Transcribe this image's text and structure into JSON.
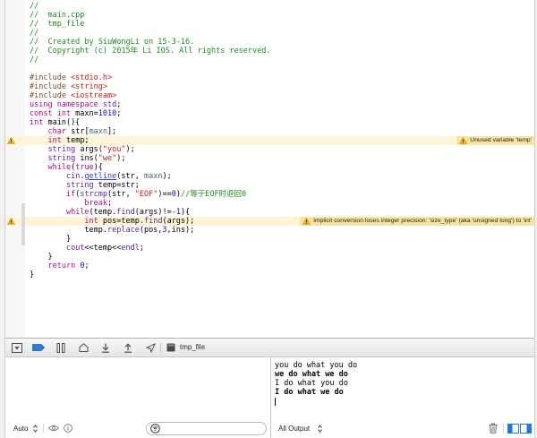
{
  "editor": {
    "lines": [
      {
        "tokens": [
          {
            "t": "//",
            "k": "cm"
          }
        ]
      },
      {
        "tokens": [
          {
            "t": "//  main.cpp",
            "k": "cm"
          }
        ]
      },
      {
        "tokens": [
          {
            "t": "//  tmp_file",
            "k": "cm"
          }
        ]
      },
      {
        "tokens": [
          {
            "t": "//",
            "k": "cm"
          }
        ]
      },
      {
        "tokens": [
          {
            "t": "//  Created by SiuWongLi on 15-3-16.",
            "k": "cm"
          }
        ]
      },
      {
        "tokens": [
          {
            "t": "//  Copyright (c) 2015年 Li IOS. All rights reserved.",
            "k": "cm"
          }
        ]
      },
      {
        "tokens": [
          {
            "t": "//",
            "k": "cm"
          }
        ]
      },
      {
        "tokens": []
      },
      {
        "tokens": [
          {
            "t": "#include ",
            "k": "pp"
          },
          {
            "t": "<stdio.h>",
            "k": "st"
          }
        ]
      },
      {
        "tokens": [
          {
            "t": "#include ",
            "k": "pp"
          },
          {
            "t": "<string>",
            "k": "st"
          }
        ]
      },
      {
        "tokens": [
          {
            "t": "#include ",
            "k": "pp"
          },
          {
            "t": "<iostream>",
            "k": "st"
          }
        ]
      },
      {
        "tokens": [
          {
            "t": "using namespace",
            "k": "kw"
          },
          {
            "t": " "
          },
          {
            "t": "std",
            "k": "sy"
          },
          {
            "t": ";"
          }
        ]
      },
      {
        "tokens": [
          {
            "t": "const int",
            "k": "kw"
          },
          {
            "t": " maxn="
          },
          {
            "t": "1010",
            "k": "nm"
          },
          {
            "t": ";"
          }
        ]
      },
      {
        "tokens": [
          {
            "t": "int",
            "k": "kw"
          },
          {
            "t": " main(){"
          }
        ]
      },
      {
        "tokens": [
          {
            "t": "    "
          },
          {
            "t": "char",
            "k": "kw"
          },
          {
            "t": " str["
          },
          {
            "t": "maxn",
            "k": "pj"
          },
          {
            "t": "];"
          }
        ]
      },
      {
        "tokens": [
          {
            "t": "    "
          },
          {
            "t": "int",
            "k": "kw"
          },
          {
            "t": " temp;"
          }
        ],
        "warning": "Unused variable 'temp'"
      },
      {
        "tokens": [
          {
            "t": "    "
          },
          {
            "t": "string",
            "k": "sy"
          },
          {
            "t": " args("
          },
          {
            "t": "\"you\"",
            "k": "st"
          },
          {
            "t": ");"
          }
        ]
      },
      {
        "tokens": [
          {
            "t": "    "
          },
          {
            "t": "string",
            "k": "sy"
          },
          {
            "t": " ins("
          },
          {
            "t": "\"we\"",
            "k": "st"
          },
          {
            "t": ");"
          }
        ]
      },
      {
        "tokens": [
          {
            "t": "    "
          },
          {
            "t": "while",
            "k": "kw"
          },
          {
            "t": "("
          },
          {
            "t": "true",
            "k": "kw"
          },
          {
            "t": "){"
          }
        ]
      },
      {
        "tokens": [
          {
            "t": "        "
          },
          {
            "t": "cin",
            "k": "sy"
          },
          {
            "t": "."
          },
          {
            "t": "getline",
            "k": "lk"
          },
          {
            "t": "(str, "
          },
          {
            "t": "maxn",
            "k": "pj"
          },
          {
            "t": ");"
          }
        ]
      },
      {
        "tokens": [
          {
            "t": "        "
          },
          {
            "t": "string",
            "k": "sy"
          },
          {
            "t": " temp=str;"
          }
        ]
      },
      {
        "tokens": [
          {
            "t": "        "
          },
          {
            "t": "if",
            "k": "kw"
          },
          {
            "t": "("
          },
          {
            "t": "strcmp",
            "k": "sy"
          },
          {
            "t": "(str, "
          },
          {
            "t": "\"EOF\"",
            "k": "st"
          },
          {
            "t": ")=="
          },
          {
            "t": "0",
            "k": "nm"
          },
          {
            "t": ")"
          },
          {
            "t": "//等于EOF时退回0",
            "k": "cm"
          }
        ]
      },
      {
        "tokens": [
          {
            "t": "            "
          },
          {
            "t": "break",
            "k": "kw"
          },
          {
            "t": ";"
          }
        ]
      },
      {
        "tokens": [
          {
            "t": "        "
          },
          {
            "t": "while",
            "k": "kw"
          },
          {
            "t": "(temp."
          },
          {
            "t": "find",
            "k": "sy"
          },
          {
            "t": "(args)!="
          },
          {
            "t": "-1",
            "k": "nm"
          },
          {
            "t": "){"
          }
        ]
      },
      {
        "tokens": [
          {
            "t": "            "
          },
          {
            "t": "int",
            "k": "kw"
          },
          {
            "t": " pos=temp."
          },
          {
            "t": "find",
            "k": "sy"
          },
          {
            "t": "(args);"
          }
        ],
        "warning": "Implicit conversion loses integer precision: 'size_type' (aka 'unsigned long') to 'int'"
      },
      {
        "tokens": [
          {
            "t": "            temp."
          },
          {
            "t": "replace",
            "k": "sy"
          },
          {
            "t": "(pos,"
          },
          {
            "t": "3",
            "k": "nm"
          },
          {
            "t": ",ins);"
          }
        ]
      },
      {
        "tokens": [
          {
            "t": "        }"
          }
        ]
      },
      {
        "tokens": [
          {
            "t": "        "
          },
          {
            "t": "cout",
            "k": "sy"
          },
          {
            "t": "<<temp<<"
          },
          {
            "t": "endl",
            "k": "sy"
          },
          {
            "t": ";"
          }
        ]
      },
      {
        "tokens": [
          {
            "t": "    }"
          }
        ]
      },
      {
        "tokens": [
          {
            "t": "    "
          },
          {
            "t": "return",
            "k": "kw"
          },
          {
            "t": " "
          },
          {
            "t": "0",
            "k": "nm"
          },
          {
            "t": ";"
          }
        ]
      },
      {
        "tokens": [
          {
            "t": "}"
          }
        ]
      }
    ]
  },
  "debug_bar": {
    "target_label": "tmp_file"
  },
  "variables_pane": {
    "scope_label": "Auto"
  },
  "console": {
    "output_filter": "All Output",
    "lines": [
      {
        "text": "you do what you do",
        "bold": false
      },
      {
        "text": "we do what we do",
        "bold": true
      },
      {
        "text": "I do what you do",
        "bold": false
      },
      {
        "text": "I do what we do",
        "bold": true
      }
    ]
  },
  "icons": {
    "editor": [
      "warning-icon"
    ],
    "debug_bar": [
      "hide-debug-area-icon",
      "breakpoints-icon",
      "pause-icon",
      "step-over-icon",
      "step-into-icon",
      "step-out-icon",
      "simulate-location-icon",
      "target-icon"
    ],
    "variables_bar": [
      "chevron-updown-icon",
      "eye-icon",
      "info-icon",
      "filter-icon"
    ],
    "console_bar": [
      "chevron-updown-icon",
      "trash-icon",
      "variables-view-icon",
      "console-view-icon"
    ]
  },
  "colors": {
    "syntax": {
      "cm": "#1d8a1d",
      "pp": "#78492a",
      "st": "#c41a16",
      "kw": "#aa0d91",
      "nm": "#1c00cf",
      "sy": "#5c2699",
      "pj": "#3f6e74",
      "lk": "#2b3fd4",
      "pl": "#000000"
    },
    "warning_highlight": "#fcf4d4",
    "warning_badge": "#f7e4a0",
    "warning_icon": "#f0b429",
    "accent": "#1d7ae4"
  }
}
